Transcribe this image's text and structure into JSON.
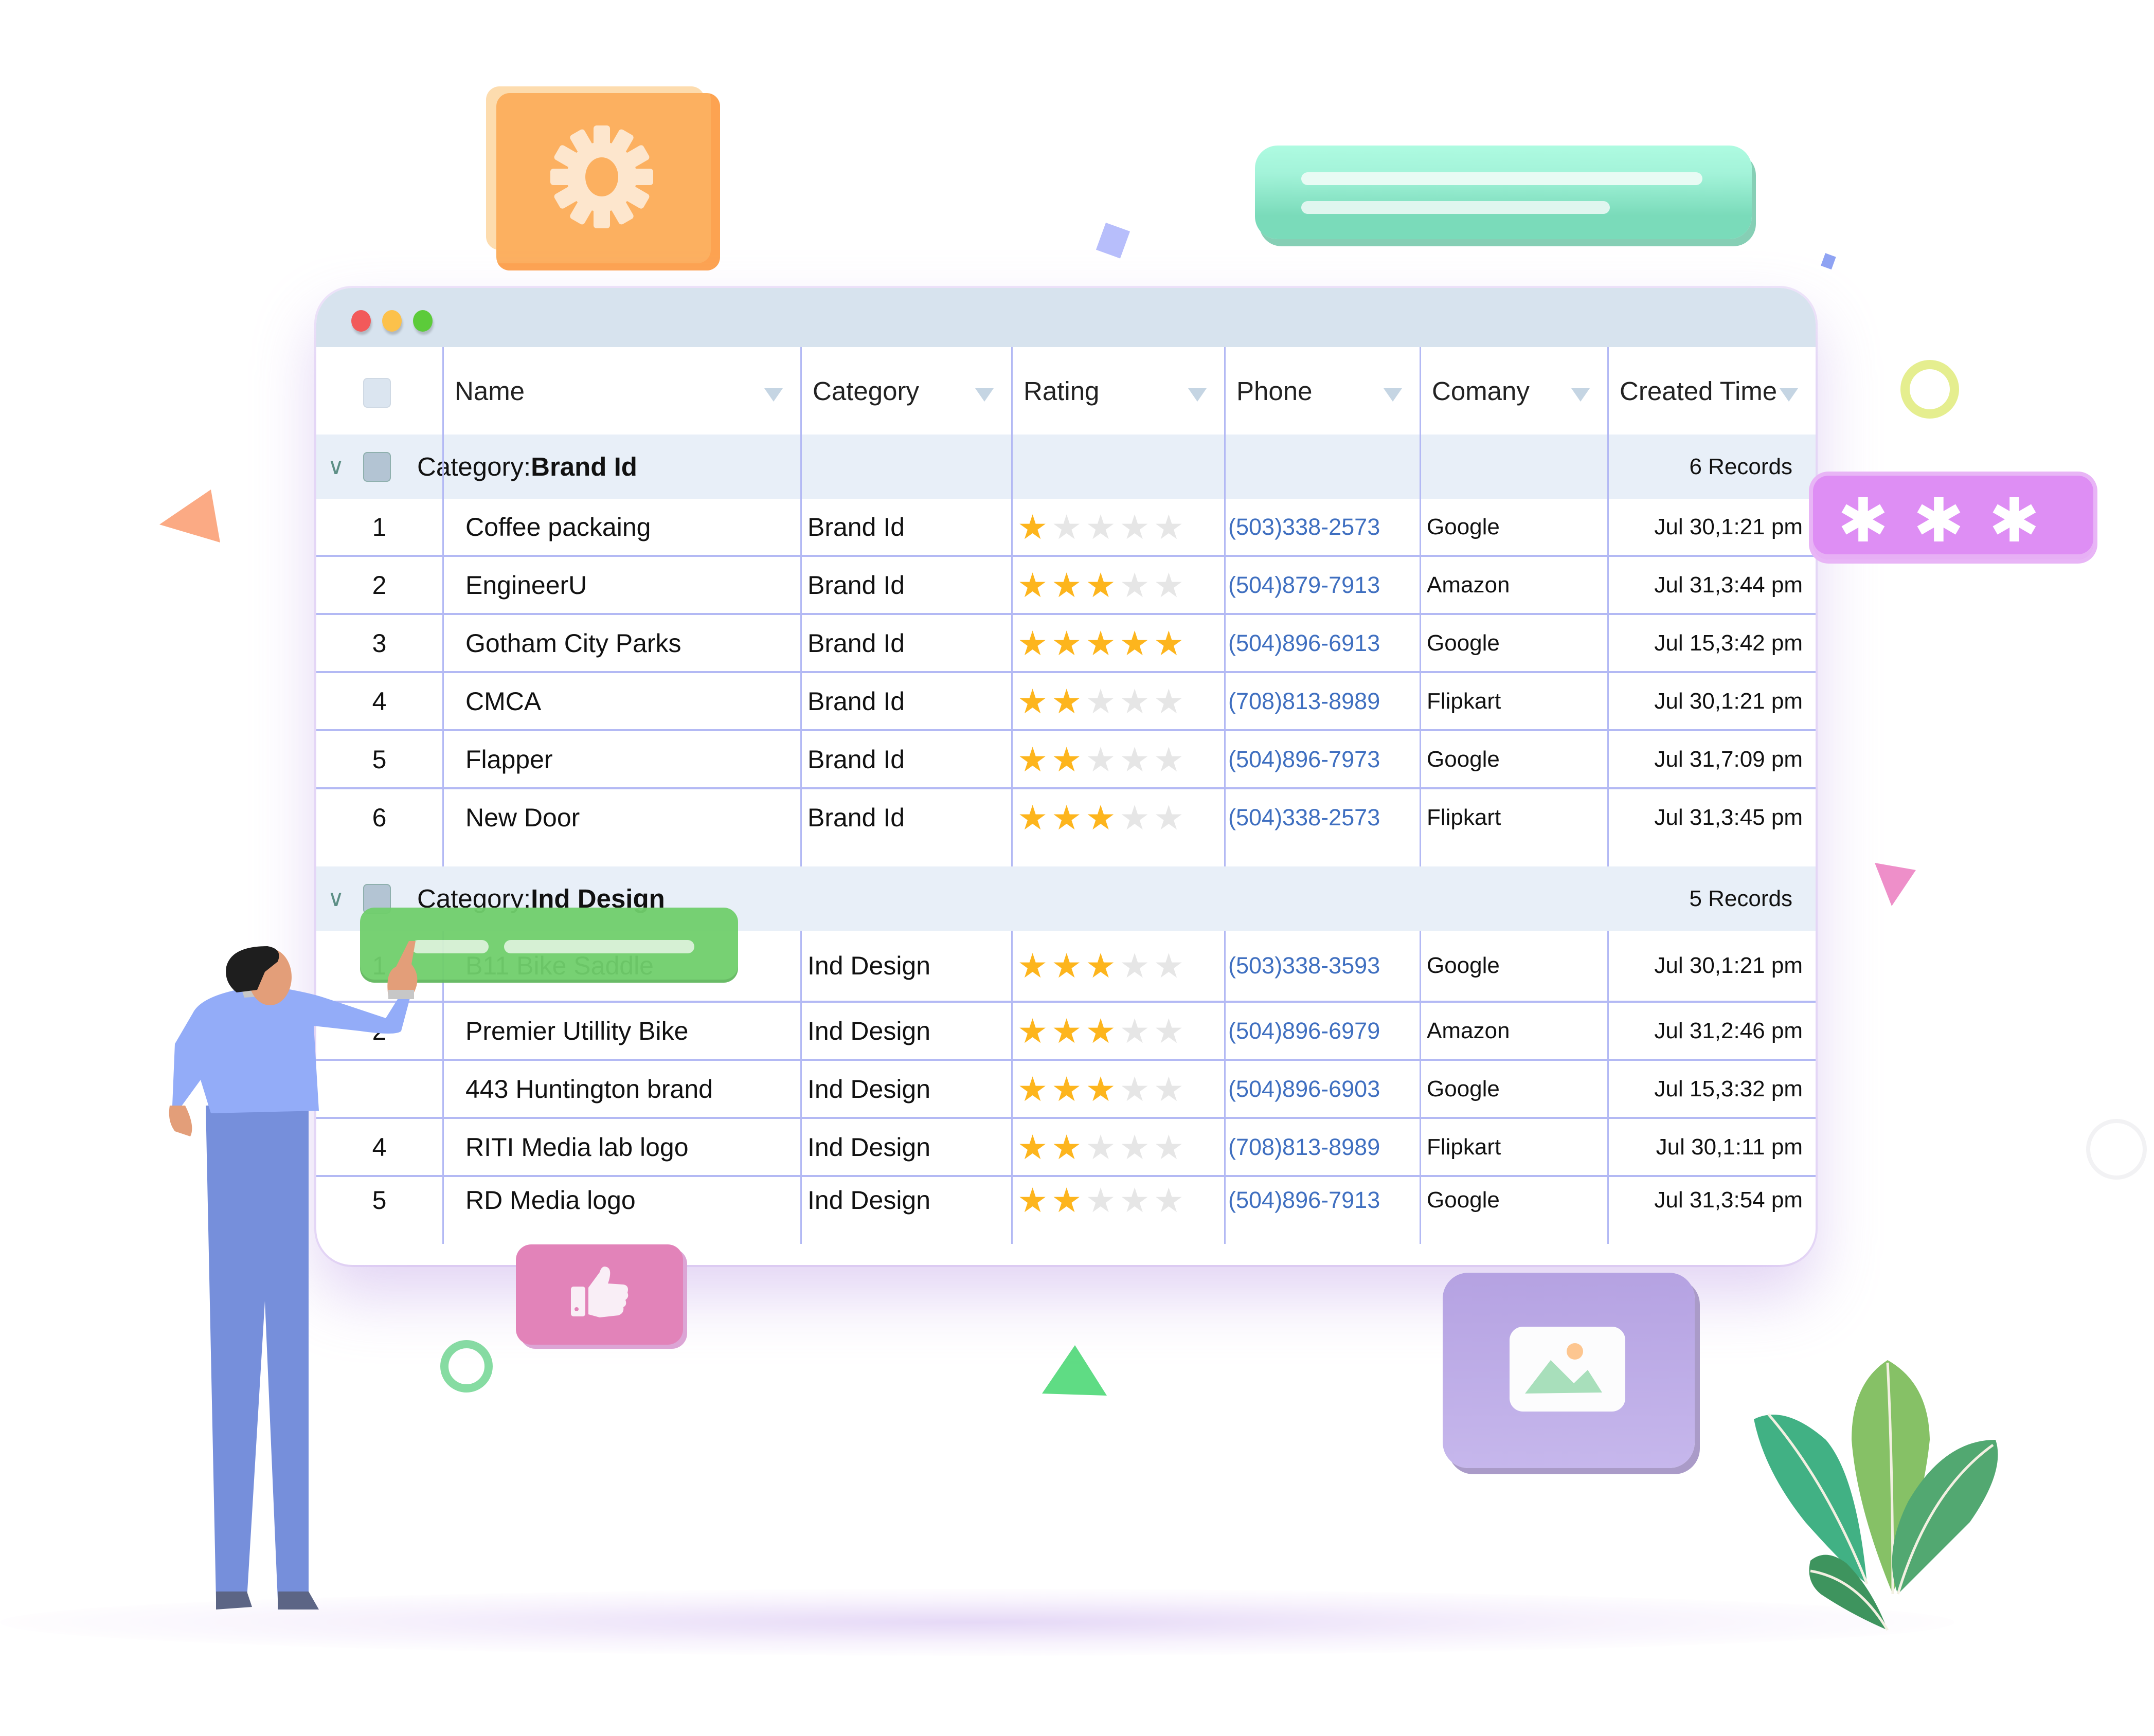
{
  "window": {
    "controls": [
      {
        "name": "close",
        "color": "#f25a5a"
      },
      {
        "name": "minimize",
        "color": "#fcc14b"
      },
      {
        "name": "maximize",
        "color": "#5ccb3a"
      }
    ]
  },
  "table": {
    "columns": [
      {
        "key": "name",
        "label": "Name"
      },
      {
        "key": "category",
        "label": "Category"
      },
      {
        "key": "rating",
        "label": "Rating"
      },
      {
        "key": "phone",
        "label": "Phone"
      },
      {
        "key": "company",
        "label": "Comany"
      },
      {
        "key": "created_time",
        "label": "Created Time"
      }
    ],
    "max_rating": 5,
    "groups": [
      {
        "title": "Category: ",
        "title_value": "Brand Id",
        "count": "6 Records",
        "rows": [
          {
            "index": "1",
            "name": "Coffee packaing",
            "category": "Brand Id",
            "rating": 1,
            "phone": "(503)338-2573",
            "company": "Google",
            "created_time": "Jul 30,1:21 pm"
          },
          {
            "index": "2",
            "name": "EngineerU",
            "category": "Brand Id",
            "rating": 3,
            "phone": "(504)879-7913",
            "company": "Amazon",
            "created_time": "Jul 31,3:44 pm"
          },
          {
            "index": "3",
            "name": "Gotham City Parks",
            "category": "Brand Id",
            "rating": 5,
            "phone": "(504)896-6913",
            "company": "Google",
            "created_time": "Jul 15,3:42 pm"
          },
          {
            "index": "4",
            "name": "CMCA",
            "category": "Brand Id",
            "rating": 2,
            "phone": "(708)813-8989",
            "company": "Flipkart",
            "created_time": "Jul 30,1:21 pm"
          },
          {
            "index": "5",
            "name": "Flapper",
            "category": "Brand Id",
            "rating": 2,
            "phone": "(504)896-7973",
            "company": "Google",
            "created_time": "Jul 31,7:09 pm"
          },
          {
            "index": "6",
            "name": "New Door",
            "category": "Brand Id",
            "rating": 3,
            "phone": "(504)338-2573",
            "company": "Flipkart",
            "created_time": "Jul 31,3:45 pm"
          }
        ]
      },
      {
        "title": "Category: ",
        "title_value": "Ind Design",
        "count": "5 Records",
        "rows": [
          {
            "index": "1",
            "name": "B11 Bike Saddle",
            "category": "Ind Design",
            "rating": 3,
            "phone": "(503)338-3593",
            "company": "Google",
            "created_time": "Jul 30,1:21 pm"
          },
          {
            "index": "2",
            "name": "Premier Utillity Bike",
            "category": "Ind Design",
            "rating": 3,
            "phone": "(504)896-6979",
            "company": "Amazon",
            "created_time": "Jul 31,2:46 pm"
          },
          {
            "index": "",
            "name": "443 Huntington brand",
            "category": "Ind Design",
            "rating": 3,
            "phone": "(504)896-6903",
            "company": "Google",
            "created_time": "Jul 15,3:32 pm"
          },
          {
            "index": "4",
            "name": "RITI Media lab logo",
            "category": "Ind Design",
            "rating": 2,
            "phone": "(708)813-8989",
            "company": "Flipkart",
            "created_time": "Jul 30,1:11 pm"
          },
          {
            "index": "5",
            "name": "RD Media logo",
            "category": "Ind Design",
            "rating": 2,
            "phone": "(504)896-7913",
            "company": "Google",
            "created_time": "Jul 31,3:54 pm"
          }
        ]
      }
    ]
  },
  "icons": {
    "star_glyph": "★",
    "asterisk_glyph": "✱",
    "chevron_glyph": "∨"
  },
  "colors": {
    "star_on": "#fdb51d",
    "star_off": "#e6e6e6",
    "phone_link": "#3f6fc0",
    "grid_line": "#b3b9f4",
    "group_bg": "#e8eff8",
    "titlebar_bg": "#d7e3ee"
  }
}
